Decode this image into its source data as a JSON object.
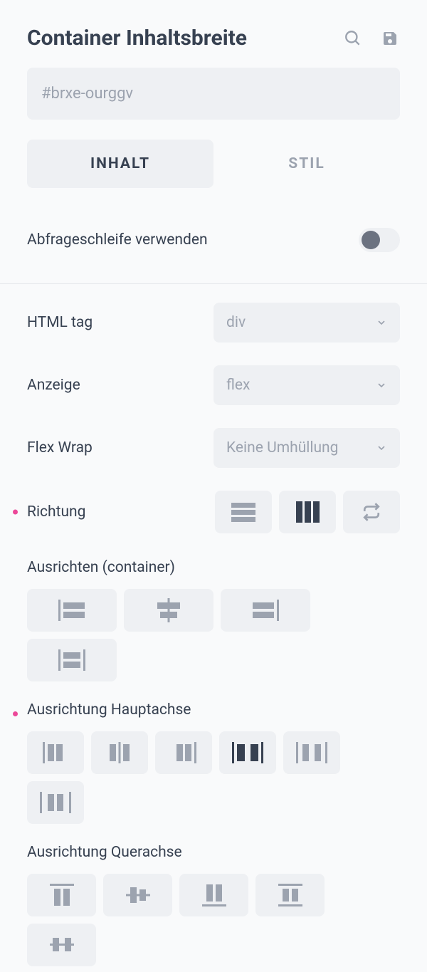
{
  "header": {
    "title": "Container Inhaltsbreite"
  },
  "element_id": "#brxe-ourggv",
  "tabs": {
    "content": "INHALT",
    "style": "STIL"
  },
  "query_loop": {
    "label": "Abfrageschleife verwenden",
    "enabled": false
  },
  "html_tag": {
    "label": "HTML tag",
    "value": "div"
  },
  "display": {
    "label": "Anzeige",
    "value": "flex"
  },
  "flex_wrap": {
    "label": "Flex Wrap",
    "value": "Keine Umhüllung"
  },
  "direction": {
    "label": "Richtung",
    "modified": true
  },
  "align_container": {
    "label": "Ausrichten (container)"
  },
  "justify_main": {
    "label": "Ausrichtung Hauptachse",
    "modified": true
  },
  "align_cross": {
    "label": "Ausrichtung Querachse"
  }
}
